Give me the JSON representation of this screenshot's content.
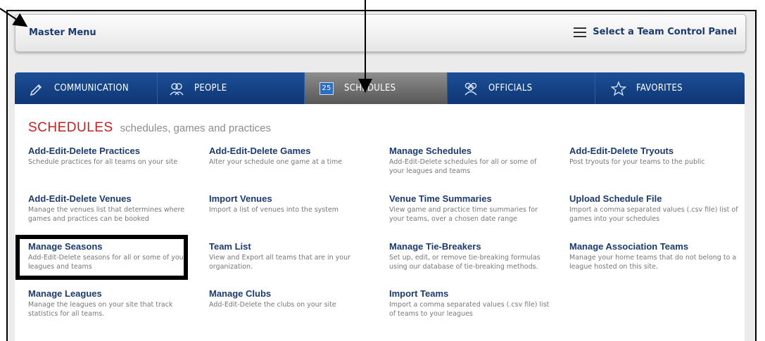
{
  "master_menu": {
    "title": "Master Menu",
    "team_panel_label": "Select a Team Control Panel"
  },
  "tabs": [
    {
      "label": "COMMUNICATION",
      "icon": "pencil-icon"
    },
    {
      "label": "PEOPLE",
      "icon": "people-icon"
    },
    {
      "label": "SCHEDULES",
      "icon": "calendar-icon",
      "calendar_number": "25",
      "active": true
    },
    {
      "label": "OFFICIALS",
      "icon": "officials-icon"
    },
    {
      "label": "FAVORITES",
      "icon": "star-icon"
    }
  ],
  "section": {
    "title": "SCHEDULES",
    "subtitle": "schedules, games and practices"
  },
  "items": [
    {
      "title": "Add-Edit-Delete Practices",
      "desc": "Schedule practices for all teams on your site"
    },
    {
      "title": "Add-Edit-Delete Games",
      "desc": "Alter your schedule one game at a time"
    },
    {
      "title": "Manage Schedules",
      "desc": "Add-Edit-Delete schedules for all or some of your leagues and teams"
    },
    {
      "title": "Add-Edit-Delete Tryouts",
      "desc": "Post tryouts for your teams to the public"
    },
    {
      "title": "Add-Edit-Delete Venues",
      "desc": "Manage the venues list that determines where games and practices can be booked"
    },
    {
      "title": "Import Venues",
      "desc": "Import a list of venues into the system"
    },
    {
      "title": "Venue Time Summaries",
      "desc": "View game and practice time summaries for your teams, over a chosen date range"
    },
    {
      "title": "Upload Schedule File",
      "desc": "Import a comma separated values (.csv file) list of games into your schedules"
    },
    {
      "title": "Manage Seasons",
      "desc": "Add-Edit-Delete seasons for all or some of your leagues and teams"
    },
    {
      "title": "Team List",
      "desc": "View and Export all teams that are in your organization."
    },
    {
      "title": "Manage Tie-Breakers",
      "desc": "Set up, edit, or remove tie-breaking formulas using our database of tie-breaking methods."
    },
    {
      "title": "Manage Association Teams",
      "desc": "Manage your home teams that do not belong to a league hosted on this site."
    },
    {
      "title": "Manage Leagues",
      "desc": "Manage the leagues on your site that track statistics for all teams."
    },
    {
      "title": "Manage Clubs",
      "desc": "Add-Edit-Delete the clubs on your site"
    },
    {
      "title": "Import Teams",
      "desc": "Import a comma separated values (.csv file) list of teams to your leagues"
    }
  ]
}
